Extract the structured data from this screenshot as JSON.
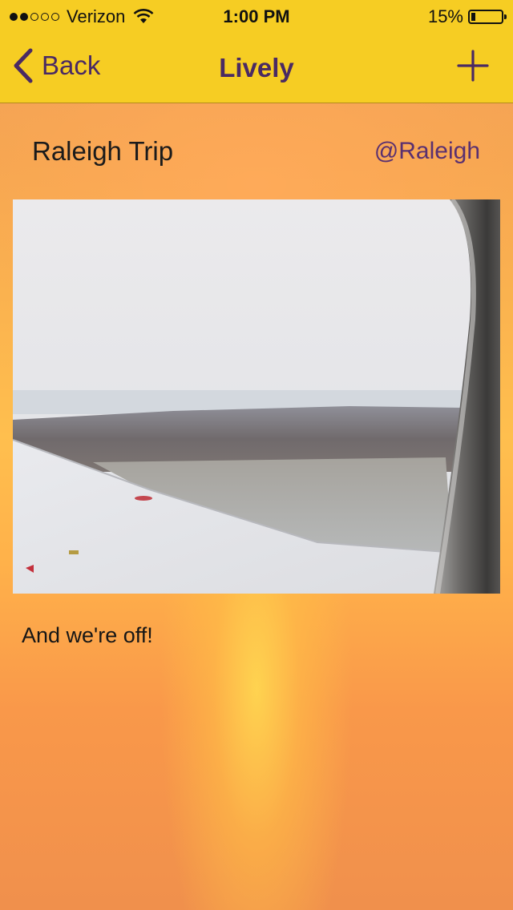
{
  "status_bar": {
    "carrier": "Verizon",
    "signal_bars_filled": 2,
    "signal_bars_total": 5,
    "time": "1:00 PM",
    "battery": "15%"
  },
  "nav": {
    "back_label": "Back",
    "title": "Lively",
    "add_icon": "plus-icon"
  },
  "post": {
    "title": "Raleigh Trip",
    "handle": "@Raleigh",
    "caption": "And we're off!"
  },
  "colors": {
    "nav_background": "#f6cd23",
    "accent_purple": "#4a2a63",
    "handle_purple": "#5a3070"
  }
}
